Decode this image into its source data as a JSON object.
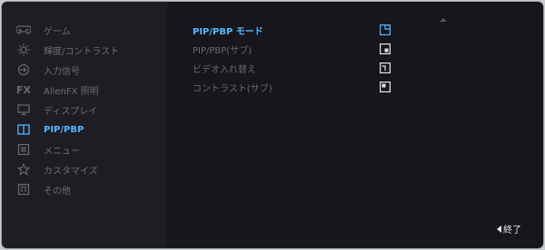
{
  "sidebar": {
    "items": [
      {
        "label": "ゲーム",
        "icon": "gamepad-icon",
        "active": false
      },
      {
        "label": "輝度/コントラスト",
        "icon": "brightness-icon",
        "active": false
      },
      {
        "label": "入力信号",
        "icon": "input-source-icon",
        "active": false
      },
      {
        "label": "AlienFX 照明",
        "icon": "alienfx-icon",
        "icon_text": "FX",
        "active": false
      },
      {
        "label": "ディスプレイ",
        "icon": "display-icon",
        "active": false
      },
      {
        "label": "PIP/PBP",
        "icon": "pip-pbp-icon",
        "active": true
      },
      {
        "label": "メニュー",
        "icon": "menu-icon",
        "active": false
      },
      {
        "label": "カスタマイズ",
        "icon": "star-icon",
        "active": false
      },
      {
        "label": "その他",
        "icon": "info-icon",
        "active": false
      }
    ]
  },
  "main": {
    "options": [
      {
        "label": "PIP/PBP モード",
        "icon": "pip-mode-icon",
        "active": true
      },
      {
        "label": "PIP/PBP(サブ)",
        "icon": "pip-sub-icon",
        "active": false
      },
      {
        "label": "ビデオ入れ替え",
        "icon": "video-swap-icon",
        "active": false
      },
      {
        "label": "コントラスト(サブ)",
        "icon": "sub-contrast-icon",
        "active": false
      }
    ]
  },
  "footer": {
    "exit_label": "終了"
  },
  "colors": {
    "accent": "#56b6ff",
    "inactive_text": "#6e6d76",
    "panel": "#17161c",
    "sidebar": "#1e1d24",
    "option_icon": "#e6e6ea"
  }
}
